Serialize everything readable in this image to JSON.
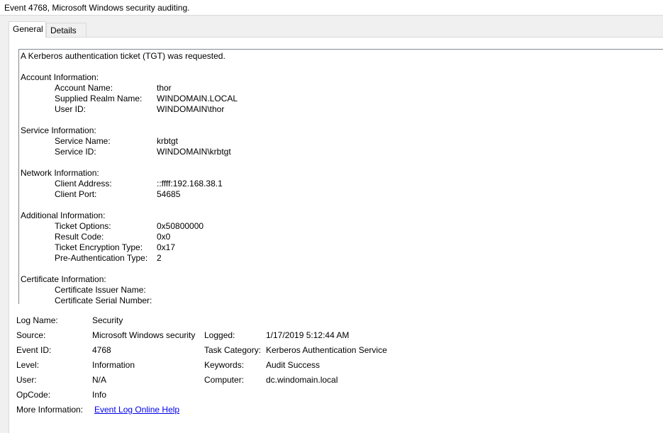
{
  "window": {
    "title": "Event 4768, Microsoft Windows security auditing."
  },
  "tabs": [
    {
      "label": "General",
      "active": true
    },
    {
      "label": "Details",
      "active": false
    }
  ],
  "description": {
    "summary": "A Kerberos authentication ticket (TGT) was requested.",
    "account": {
      "heading": "Account Information:",
      "rows": [
        {
          "label": "Account Name:",
          "value": "thor"
        },
        {
          "label": "Supplied Realm Name:",
          "value": "WINDOMAIN.LOCAL"
        },
        {
          "label": "User ID:",
          "value": "WINDOMAIN\\thor"
        }
      ]
    },
    "service": {
      "heading": "Service Information:",
      "rows": [
        {
          "label": "Service Name:",
          "value": "krbtgt"
        },
        {
          "label": "Service ID:",
          "value": "WINDOMAIN\\krbtgt"
        }
      ]
    },
    "network": {
      "heading": "Network Information:",
      "rows": [
        {
          "label": "Client Address:",
          "value": "::ffff:192.168.38.1"
        },
        {
          "label": "Client Port:",
          "value": "54685"
        }
      ]
    },
    "additional": {
      "heading": "Additional Information:",
      "rows": [
        {
          "label": "Ticket Options:",
          "value": "0x50800000"
        },
        {
          "label": "Result Code:",
          "value": "0x0"
        },
        {
          "label": "Ticket Encryption Type:",
          "value": "0x17"
        },
        {
          "label": "Pre-Authentication Type:",
          "value": "2"
        }
      ]
    },
    "certificate": {
      "heading": "Certificate Information:",
      "rows": [
        {
          "label": "Certificate Issuer Name:",
          "value": ""
        },
        {
          "label": "Certificate Serial Number:",
          "value": ""
        }
      ]
    }
  },
  "meta": {
    "log_name": {
      "label": "Log Name:",
      "value": "Security"
    },
    "source": {
      "label": "Source:",
      "value": "Microsoft Windows security"
    },
    "logged": {
      "label": "Logged:",
      "value": "1/17/2019 5:12:44 AM"
    },
    "event_id": {
      "label": "Event ID:",
      "value": "4768"
    },
    "task_category": {
      "label": "Task Category:",
      "value": "Kerberos Authentication Service"
    },
    "level": {
      "label": "Level:",
      "value": "Information"
    },
    "keywords": {
      "label": "Keywords:",
      "value": "Audit Success"
    },
    "user": {
      "label": "User:",
      "value": "N/A"
    },
    "computer": {
      "label": "Computer:",
      "value": "dc.windomain.local"
    },
    "opcode": {
      "label": "OpCode:",
      "value": "Info"
    },
    "more_info": {
      "label": "More Information:",
      "link": "Event Log Online Help"
    }
  },
  "colors": {
    "link": "#0000ee",
    "border": "#828790",
    "background": "#f0f0f0"
  }
}
